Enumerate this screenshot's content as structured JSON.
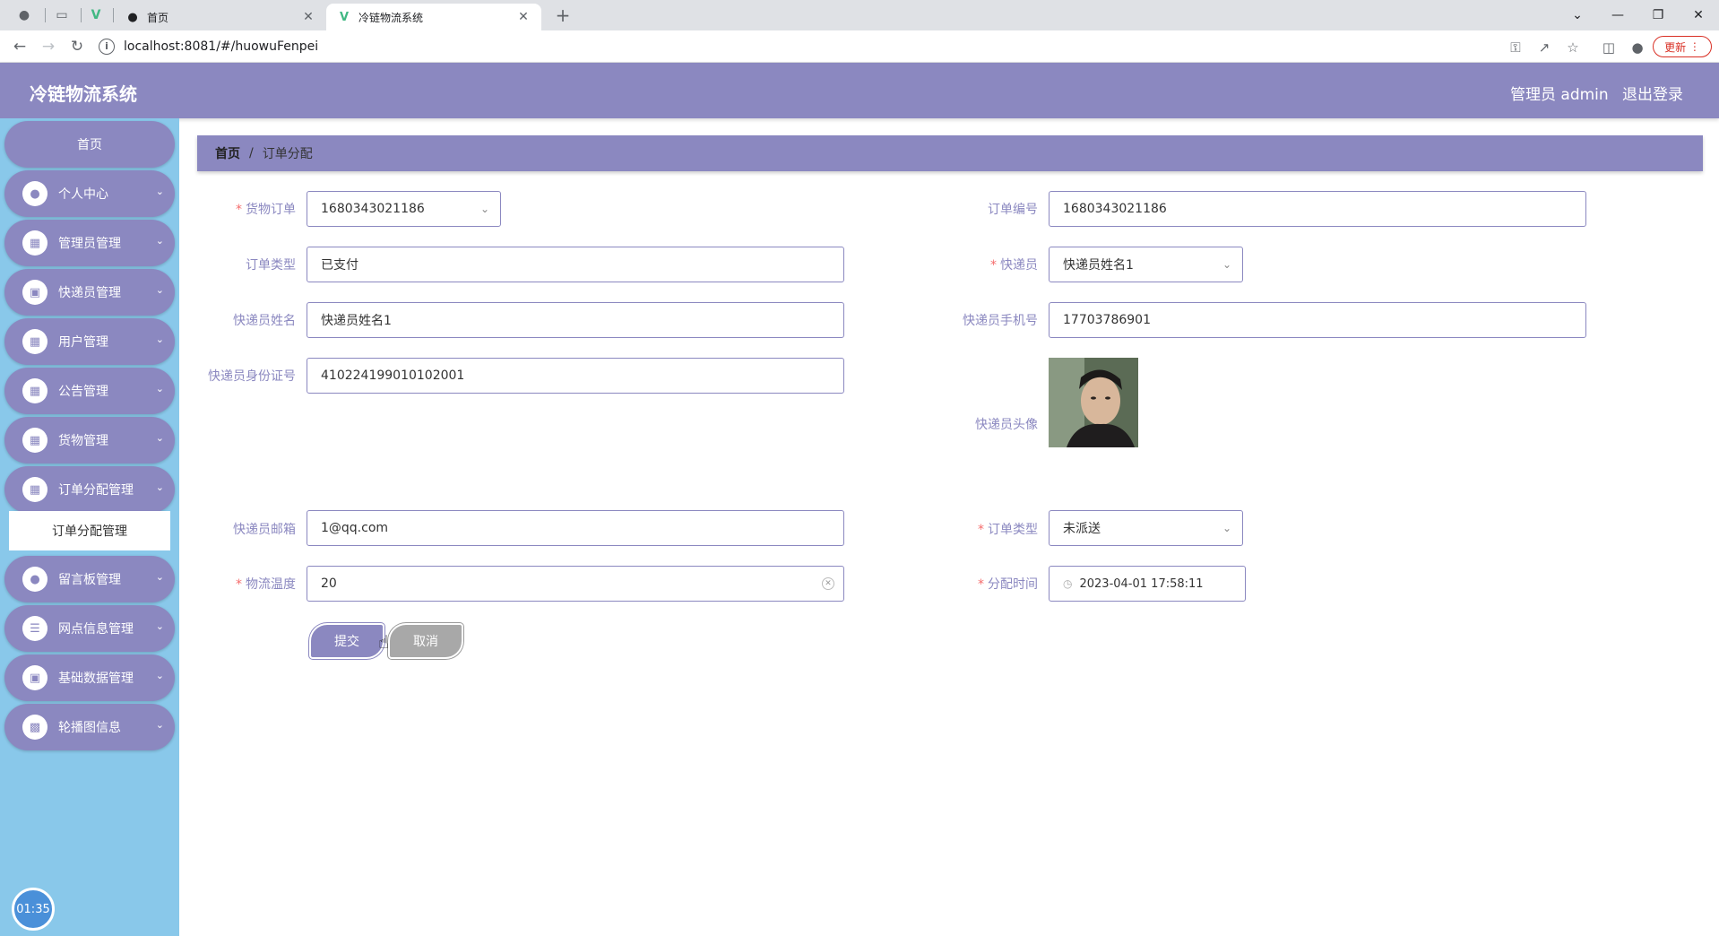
{
  "browser": {
    "tabs": [
      {
        "title": "首页",
        "active": false
      },
      {
        "title": "冷链物流系统",
        "active": true
      }
    ],
    "url": "localhost:8081/#/huowuFenpei",
    "update_label": "更新"
  },
  "header": {
    "app_title": "冷链物流系统",
    "user_label": "管理员 admin",
    "logout_label": "退出登录"
  },
  "sidebar": {
    "home_label": "首页",
    "items": [
      {
        "label": "个人中心",
        "icon": "user-icon"
      },
      {
        "label": "管理员管理",
        "icon": "grid-icon"
      },
      {
        "label": "快递员管理",
        "icon": "monitor-icon"
      },
      {
        "label": "用户管理",
        "icon": "grid-icon"
      },
      {
        "label": "公告管理",
        "icon": "grid-icon"
      },
      {
        "label": "货物管理",
        "icon": "grid-icon"
      },
      {
        "label": "订单分配管理",
        "icon": "apps-icon"
      },
      {
        "label": "留言板管理",
        "icon": "user-icon"
      },
      {
        "label": "网点信息管理",
        "icon": "sliders-icon"
      },
      {
        "label": "基础数据管理",
        "icon": "monitor-icon"
      },
      {
        "label": "轮播图信息",
        "icon": "briefcase-icon"
      }
    ],
    "submenu_label": "订单分配管理",
    "clock_time": "01:35"
  },
  "breadcrumb": {
    "home": "首页",
    "separator": "/",
    "current": "订单分配"
  },
  "form": {
    "huowu_order": {
      "label": "货物订单",
      "value": "1680343021186",
      "required": true
    },
    "order_no": {
      "label": "订单编号",
      "value": "1680343021186",
      "required": false
    },
    "order_type_paid": {
      "label": "订单类型",
      "value": "已支付",
      "required": false
    },
    "courier": {
      "label": "快递员",
      "value": "快递员姓名1",
      "required": true
    },
    "courier_name": {
      "label": "快递员姓名",
      "value": "快递员姓名1",
      "required": false
    },
    "courier_phone": {
      "label": "快递员手机号",
      "value": "17703786901",
      "required": false
    },
    "courier_id": {
      "label": "快递员身份证号",
      "value": "410224199010102001",
      "required": false
    },
    "courier_avatar": {
      "label": "快递员头像",
      "required": false
    },
    "courier_email": {
      "label": "快递员邮箱",
      "value": "1@qq.com",
      "required": false
    },
    "order_type_delivery": {
      "label": "订单类型",
      "value": "未派送",
      "required": true
    },
    "temperature": {
      "label": "物流温度",
      "value": "20",
      "required": true
    },
    "assign_time": {
      "label": "分配时间",
      "value": "2023-04-01 17:58:11",
      "required": true
    },
    "submit_label": "提交",
    "cancel_label": "取消"
  },
  "colors": {
    "primary": "#8b88c0",
    "sidebar_bg": "#89c8ea",
    "required": "#f56c6c"
  }
}
